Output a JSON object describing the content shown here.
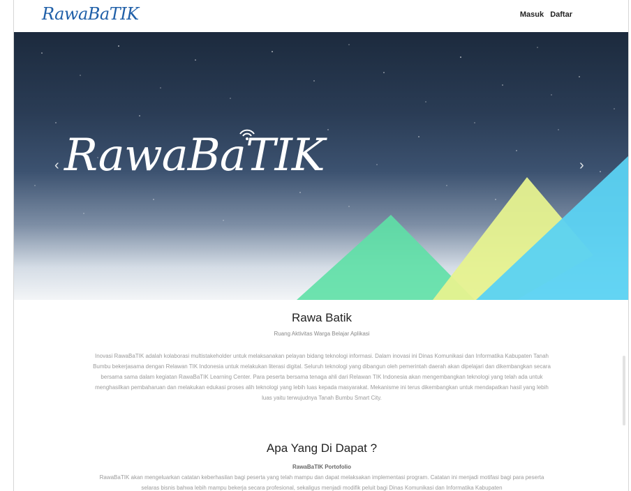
{
  "navbar": {
    "logo_text": "RawaBaTIK",
    "login_label": "Masuk",
    "register_label": "Daftar"
  },
  "hero": {
    "logo_text": "RawaBaTIK",
    "prev_arrow": "‹",
    "next_arrow": "›",
    "triangle_colors": [
      "#5ee0a6",
      "#e6f28f",
      "#5bd2f2"
    ]
  },
  "about": {
    "title": "Rawa Batik",
    "subtitle": "Ruang Aktivitas Warga Belajar Aplikasi",
    "paragraph": "Inovasi RawaBaTIK adalah kolaborasi multistakeholder untuk melaksanakan pelayan bidang teknologi informasi. Dalam inovasi ini Dinas Komunikasi dan Informatika Kabupaten Tanah Bumbu bekerjasama dengan Relawan TIK Indonesia untuk melakukan literasi digital. Seluruh teknologi yang dibangun oleh pemerintah daerah akan dipelajari dan dikembangkan secara bersama sama dalam kegiatan RawaBaTIK Learning Center. Para peserta bersama tenaga ahli dari Relawan TIK Indonesia akan mengembangkan teknologi yang telah ada untuk menghasilkan pembaharuan dan melakukan edukasi proses alih teknologi yang lebih luas kepada masyarakat. Mekanisme ini terus dikembangkan untuk mendapatkan hasil yang lebih luas yaitu terwujudnya Tanah Bumbu Smart City."
  },
  "benefits": {
    "title": "Apa Yang Di Dapat ?",
    "portfolio_title": "RawaBaTIK Portofolio",
    "portfolio_text": "RawaBaTIK akan mengeluarkan catatan keberhasilan bagi peserta yang telah mampu dan dapat melaksakan implementasi program. Catatan ini menjadi motifasi bagi para peserta selaras bisnis bahwa lebih mampu bekerja secara profesional, sekaligus menjadi modifik peluit bagi Dinas Komunikasi dan Informatika Kabupaten"
  }
}
